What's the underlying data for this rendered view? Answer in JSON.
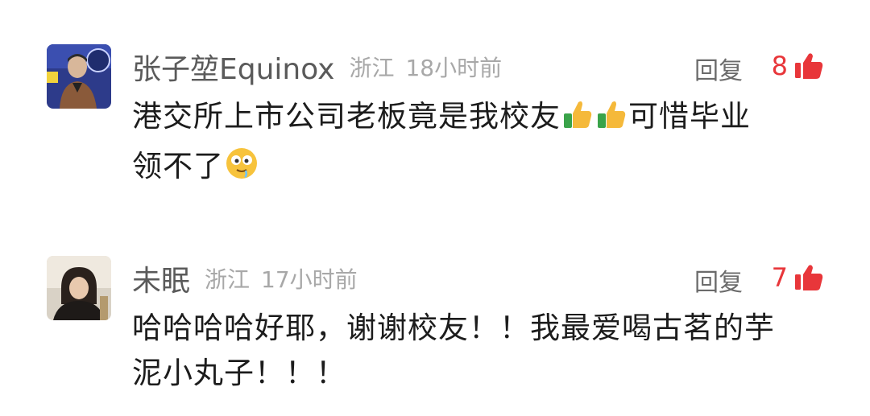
{
  "comments": [
    {
      "username": "张子堃Equinox",
      "location": "浙江",
      "time": "18小时前",
      "reply_label": "回复",
      "likes": "8",
      "text_part1": "港交所上市公司老板竟是我校友",
      "text_part2": "可惜毕业",
      "text_part3": "领不了",
      "emojis": [
        "thumbs-up-emoji",
        "thumbs-up-emoji",
        "drooling-face-emoji"
      ]
    },
    {
      "username": "未眠",
      "location": "浙江",
      "time": "17小时前",
      "reply_label": "回复",
      "likes": "7",
      "text_line1": "哈哈哈哈好耶，谢谢校友！！我最爱喝古茗的芋",
      "text_line2": "泥小丸子！！！"
    }
  ],
  "colors": {
    "like_red": "#e8363a",
    "username_gray": "#5a5a5a",
    "meta_gray": "#a8a8a8"
  }
}
